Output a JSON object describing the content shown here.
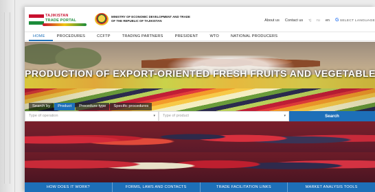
{
  "header": {
    "portal_logo_line1": "TAJIKISTAN",
    "portal_logo_line2": "TRADE PORTAL",
    "ministry_line1": "MINISTRY OF ECONOMIC DEVELOPMENT AND TRADE",
    "ministry_line2": "OF THE REPUBLIC OF TAJIKISTAN",
    "about": "About us",
    "contact": "Contact us",
    "lang_tj": "тj",
    "lang_ru": "ru",
    "lang_en": "en",
    "select_language": "SELECT LANGUAGE",
    "g_letter": "G"
  },
  "nav": {
    "items": [
      "HOME",
      "PROCEDURES",
      "CCFTP",
      "TRADING PARTNERS",
      "PRESIDENT",
      "WTO",
      "NATIONAL PRODUCERS"
    ]
  },
  "hero": {
    "title": "PRODUCTION OF EXPORT-ORIENTED FRESH FRUITS AND VEGETABLES OF T"
  },
  "search": {
    "label": "Search by",
    "tabs": [
      "Product",
      "Procedure type",
      "Specific procedures"
    ],
    "operation_placeholder": "Type of operation",
    "product_placeholder": "Type of product",
    "button": "Search",
    "caret": "▾"
  },
  "bottom_links": [
    "HOW DOES IT WORK?",
    "FORMS, LAWS AND CONTACTS",
    "TRADE FACILITATION LINKS",
    "MARKET ANALYSIS TOOLS"
  ],
  "colors": {
    "accent": "#1d6fb8",
    "brand_red": "#c8102e",
    "brand_green": "#1b8c3b"
  }
}
